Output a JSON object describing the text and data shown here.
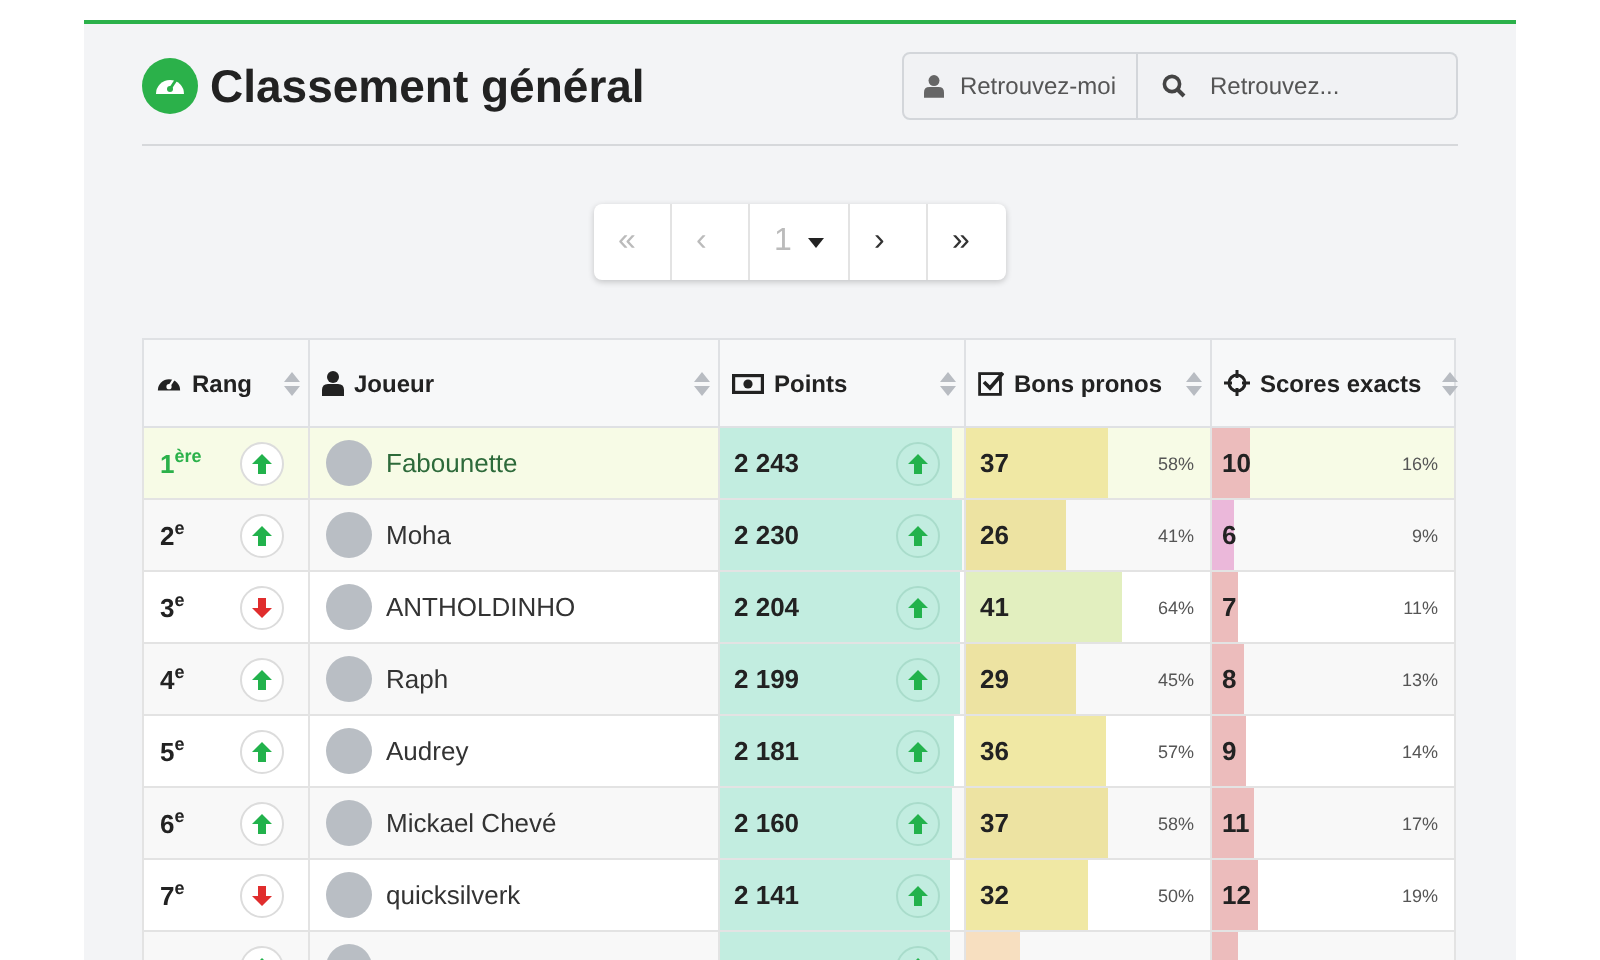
{
  "title": "Classement général",
  "find_me": {
    "label": "Retrouvez-moi"
  },
  "search": {
    "placeholder": "Retrouvez..."
  },
  "pagination": [
    {
      "kind": "first",
      "label": "«",
      "disabled": true
    },
    {
      "kind": "prev",
      "label": "‹",
      "disabled": true
    },
    {
      "kind": "page",
      "label": "1",
      "disabled": true
    },
    {
      "kind": "next",
      "label": "›",
      "disabled": false
    },
    {
      "kind": "last",
      "label": "»",
      "disabled": false
    }
  ],
  "table": {
    "columns": [
      {
        "kind": "rank",
        "label": "Rang"
      },
      {
        "kind": "player",
        "label": "Joueur"
      },
      {
        "kind": "points",
        "label": "Points"
      },
      {
        "kind": "bons",
        "label": "Bons pronos"
      },
      {
        "kind": "scores",
        "label": "Scores exacts"
      }
    ],
    "rows": [
      {
        "rank": "1$^{ère}$",
        "highlighted": true,
        "movement": {
          "kind": "up"
        },
        "player": "Fabounette",
        "points": {
          "value": "2 243",
          "level": 0.95,
          "movement": {
            "kind": "up"
          }
        },
        "bons": {
          "value": "37",
          "pct": "58%",
          "level": 0.58,
          "color": "#f0e8a4"
        },
        "scores": {
          "value": "10",
          "pct": "16%",
          "level": 0.16,
          "color": "#ecbcbc"
        }
      },
      {
        "rank": "2$^{e}$",
        "highlighted": false,
        "movement": {
          "kind": "up"
        },
        "player": "Moha",
        "points": {
          "value": "2 230",
          "level": 0.99,
          "movement": {
            "kind": "up"
          }
        },
        "bons": {
          "value": "26",
          "pct": "41%",
          "level": 0.41,
          "color": "#ede3a2"
        },
        "scores": {
          "value": "6",
          "pct": "9%",
          "level": 0.09,
          "color": "#ebb8da"
        }
      },
      {
        "rank": "3$^{e}$",
        "highlighted": false,
        "movement": {
          "kind": "down"
        },
        "player": "ANTHOLDINHO",
        "points": {
          "value": "2 204",
          "level": 0.98,
          "movement": {
            "kind": "up"
          }
        },
        "bons": {
          "value": "41",
          "pct": "64%",
          "level": 0.64,
          "color": "#e2efbf"
        },
        "scores": {
          "value": "7",
          "pct": "11%",
          "level": 0.11,
          "color": "#ecbcbc"
        }
      },
      {
        "rank": "4$^{e}$",
        "highlighted": false,
        "movement": {
          "kind": "up"
        },
        "player": "Raph",
        "points": {
          "value": "2 199",
          "level": 0.98,
          "movement": {
            "kind": "up"
          }
        },
        "bons": {
          "value": "29",
          "pct": "45%",
          "level": 0.45,
          "color": "#ede3a2"
        },
        "scores": {
          "value": "8",
          "pct": "13%",
          "level": 0.13,
          "color": "#ecbcbc"
        }
      },
      {
        "rank": "5$^{e}$",
        "highlighted": false,
        "movement": {
          "kind": "up"
        },
        "player": "Audrey",
        "points": {
          "value": "2 181",
          "level": 0.96,
          "movement": {
            "kind": "up"
          }
        },
        "bons": {
          "value": "36",
          "pct": "57%",
          "level": 0.57,
          "color": "#f0e8a4"
        },
        "scores": {
          "value": "9",
          "pct": "14%",
          "level": 0.14,
          "color": "#ecbcbc"
        }
      },
      {
        "rank": "6$^{e}$",
        "highlighted": false,
        "movement": {
          "kind": "up"
        },
        "player": "Mickael Chevé",
        "points": {
          "value": "2 160",
          "level": 0.95,
          "movement": {
            "kind": "up"
          }
        },
        "bons": {
          "value": "37",
          "pct": "58%",
          "level": 0.58,
          "color": "#ede3a2"
        },
        "scores": {
          "value": "11",
          "pct": "17%",
          "level": 0.17,
          "color": "#ecbcbc"
        }
      },
      {
        "rank": "7$^{e}$",
        "highlighted": false,
        "movement": {
          "kind": "down"
        },
        "player": "quicksilverk",
        "points": {
          "value": "2 141",
          "level": 0.94,
          "movement": {
            "kind": "up"
          }
        },
        "bons": {
          "value": "32",
          "pct": "50%",
          "level": 0.5,
          "color": "#f0e8a4"
        },
        "scores": {
          "value": "12",
          "pct": "19%",
          "level": 0.19,
          "color": "#ecbcbc"
        }
      },
      {
        "movement": {
          "kind": "up"
        },
        "points": {
          "level": 0.94,
          "movement": {
            "kind": "up"
          }
        },
        "bons": {
          "level": 0.22,
          "color": "#f7dfc0"
        },
        "scores": {
          "level": 0.11,
          "color": "#ecbcbc"
        }
      }
    ]
  }
}
